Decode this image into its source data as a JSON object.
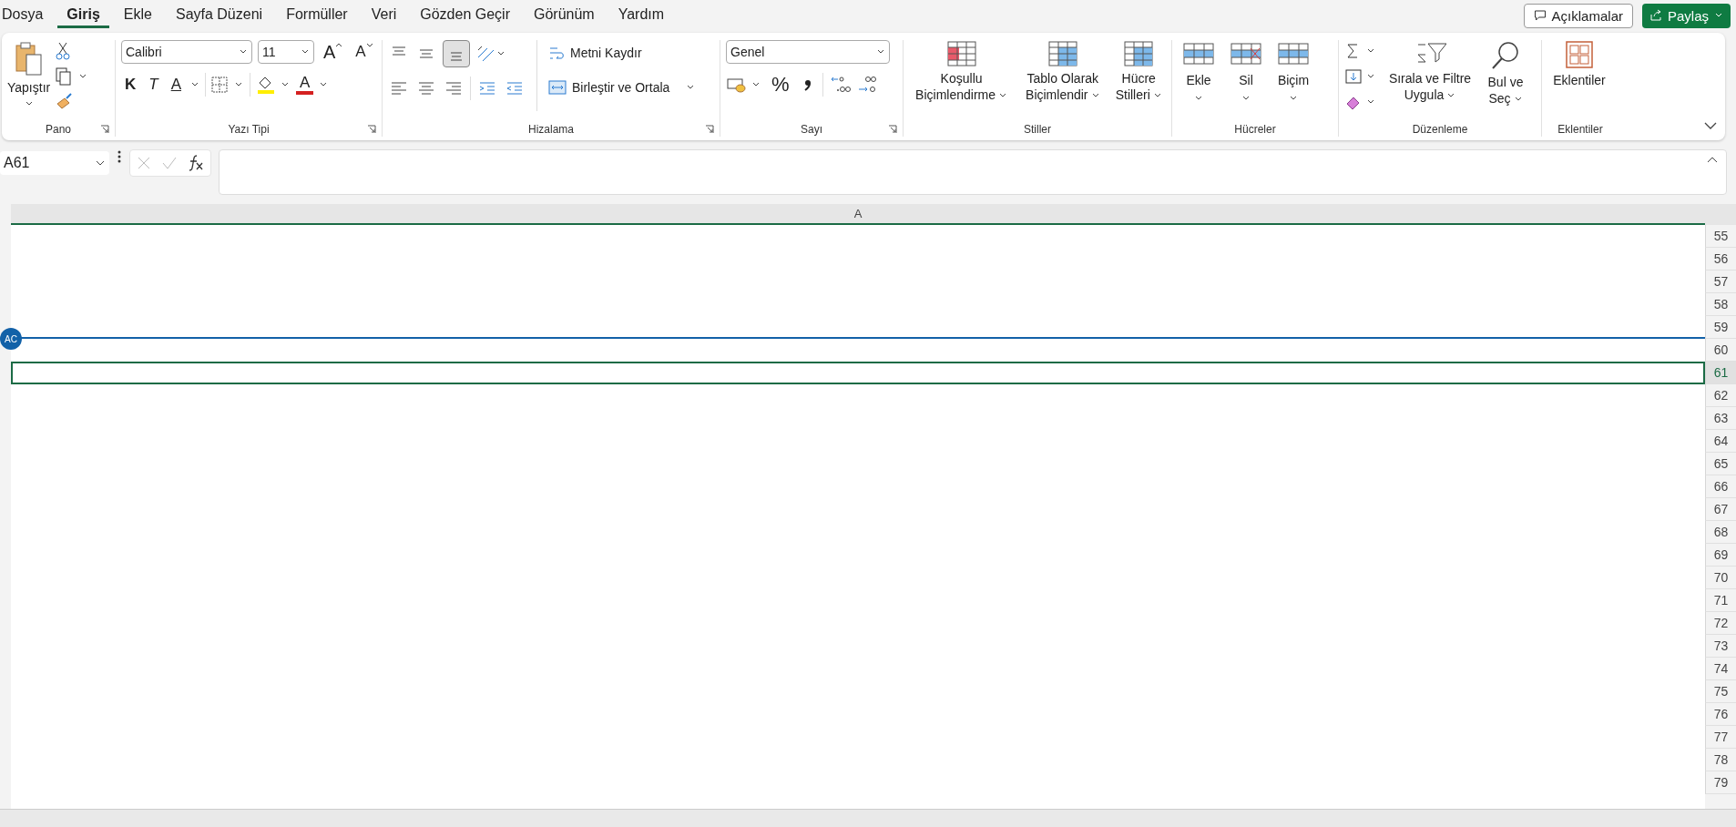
{
  "menu_tabs": [
    {
      "label": "Dosya",
      "selected": false
    },
    {
      "label": "Giriş",
      "selected": true
    },
    {
      "label": "Ekle",
      "selected": false
    },
    {
      "label": "Sayfa Düzeni",
      "selected": false
    },
    {
      "label": "Formüller",
      "selected": false
    },
    {
      "label": "Veri",
      "selected": false
    },
    {
      "label": "Gözden Geçir",
      "selected": false
    },
    {
      "label": "Görünüm",
      "selected": false
    },
    {
      "label": "Yardım",
      "selected": false
    }
  ],
  "comments_button": "Açıklamalar",
  "share_button": "Paylaş",
  "ribbon": {
    "clipboard": {
      "label": "Pano",
      "paste": "Yapıştır"
    },
    "font": {
      "label": "Yazı Tipi",
      "font_name": "Calibri",
      "font_size": "11",
      "grow": "A",
      "shrink": "A",
      "bold": "K",
      "italic": "T",
      "underline": "A",
      "font_color": "A"
    },
    "alignment": {
      "label": "Hizalama",
      "bottom_align_selected": true,
      "wrap_text": "Metni Kaydır",
      "merge": "Birleştir ve Ortala"
    },
    "number": {
      "label": "Sayı",
      "format": "Genel",
      "percent": "%"
    },
    "styles": {
      "label": "Stiller",
      "buttons": [
        "Koşullu Biçimlendirme",
        "Tablo Olarak Biçimlendir",
        "Hücre Stilleri"
      ]
    },
    "cells": {
      "label": "Hücreler",
      "buttons": [
        "Ekle",
        "Sil",
        "Biçim"
      ]
    },
    "editing": {
      "label": "Düzenleme",
      "sort": "Sırala ve Filtre Uygula",
      "find": "Bul ve Seç"
    },
    "addins": {
      "label": "Eklentiler",
      "button": "Eklentiler"
    }
  },
  "name_box": "A61",
  "sheet": {
    "column": "A",
    "presence": {
      "initials": "AC"
    },
    "rows": [
      {
        "label": "55",
        "selected": false
      },
      {
        "label": "56",
        "selected": false
      },
      {
        "label": "57",
        "selected": false
      },
      {
        "label": "58",
        "selected": false
      },
      {
        "label": "59",
        "selected": false,
        "collaborator": true
      },
      {
        "label": "60",
        "selected": false
      },
      {
        "label": "61",
        "selected": true
      },
      {
        "label": "62",
        "selected": false
      },
      {
        "label": "63",
        "selected": false
      },
      {
        "label": "64",
        "selected": false
      },
      {
        "label": "65",
        "selected": false
      },
      {
        "label": "66",
        "selected": false
      },
      {
        "label": "67",
        "selected": false
      },
      {
        "label": "68",
        "selected": false
      },
      {
        "label": "69",
        "selected": false
      },
      {
        "label": "70",
        "selected": false
      },
      {
        "label": "71",
        "selected": false
      },
      {
        "label": "72",
        "selected": false
      },
      {
        "label": "73",
        "selected": false
      },
      {
        "label": "74",
        "selected": false
      },
      {
        "label": "75",
        "selected": false
      },
      {
        "label": "76",
        "selected": false
      },
      {
        "label": "77",
        "selected": false
      },
      {
        "label": "78",
        "selected": false
      },
      {
        "label": "79",
        "selected": false
      }
    ]
  }
}
